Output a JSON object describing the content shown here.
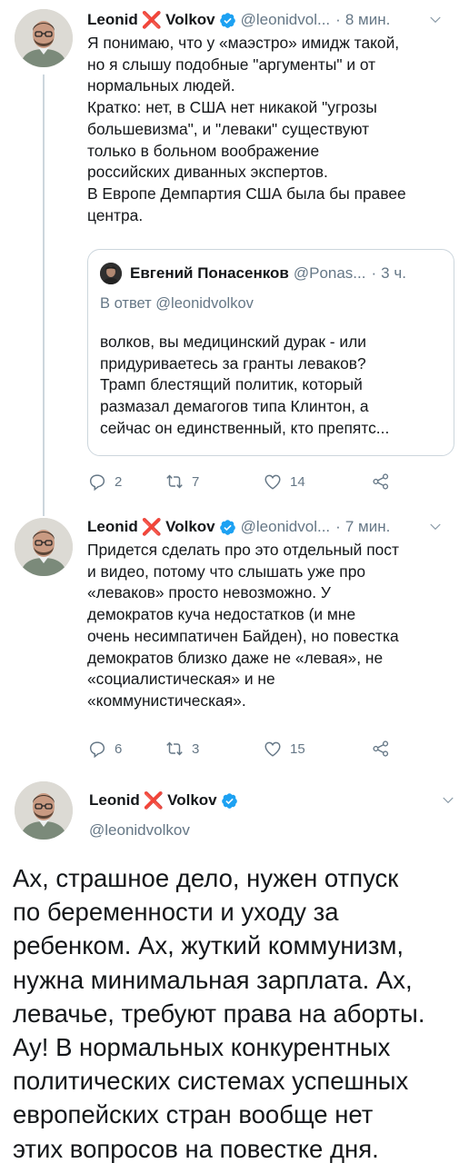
{
  "tweet1": {
    "name_first": "Leonid",
    "x_mark": "❌",
    "name_last": "Volkov",
    "handle": "@leonidvol...",
    "time": "8 мин.",
    "lines": [
      "Я понимаю, что у «маэстро» имидж такой,",
      "но я слышу подобные \"аргументы\" и от",
      "нормальных людей.",
      "Кратко: нет, в США нет никакой \"угрозы",
      "большевизма\", и \"леваки\" существуют",
      "только в больном воображение",
      "российских диванных экспертов.",
      "В Европе Демпартия США была бы правее",
      "центра."
    ],
    "quote": {
      "name": "Евгений Понасенков",
      "handle": "@Ponas...",
      "time": "3 ч.",
      "reply_to": "В ответ @leonidvolkov",
      "lines": [
        "волков, вы медицинский дурак - или",
        "придуриваетесь за гранты леваков?",
        "Трамп блестящий политик, который",
        "размазал демагогов типа Клинтон, а",
        "сейчас он единственный, кто препятс..."
      ]
    },
    "actions": {
      "replies": "2",
      "retweets": "7",
      "likes": "14"
    }
  },
  "tweet2": {
    "name_first": "Leonid",
    "x_mark": "❌",
    "name_last": "Volkov",
    "handle": "@leonidvol...",
    "time": "7 мин.",
    "lines": [
      "Придется сделать про это отдельный пост",
      "и видео, потому что слышать уже про",
      "«леваков» просто невозможно. У",
      "демократов куча недостатков (и мне",
      "очень несимпатичен Байден), но повестка",
      "демократов близко даже не «левая», не",
      "«социалистическая» и не",
      "«коммунистическая»."
    ],
    "actions": {
      "replies": "6",
      "retweets": "3",
      "likes": "15"
    }
  },
  "tweet3": {
    "name_first": "Leonid",
    "x_mark": "❌",
    "name_last": "Volkov",
    "handle": "@leonidvolkov",
    "lines": [
      "Ах, страшное дело, нужен отпуск",
      "по беременности и уходу за",
      "ребенком. Ах, жуткий коммунизм,",
      "нужна минимальная зарплата. Ах,",
      "левачье, требуют права на аборты.",
      "Ау! В нормальных конкурентных",
      "политических системах успешных",
      "европейских стран вообще нет",
      "этих вопросов на повестке дня."
    ]
  },
  "colors": {
    "verified": "#1da1f2",
    "x_mark": "#d7262e",
    "secondary": "#657786",
    "border": "#ccd6dd"
  },
  "icons": [
    "reply-icon",
    "retweet-icon",
    "like-icon",
    "share-icon",
    "chevron-down-icon",
    "verified-icon"
  ]
}
